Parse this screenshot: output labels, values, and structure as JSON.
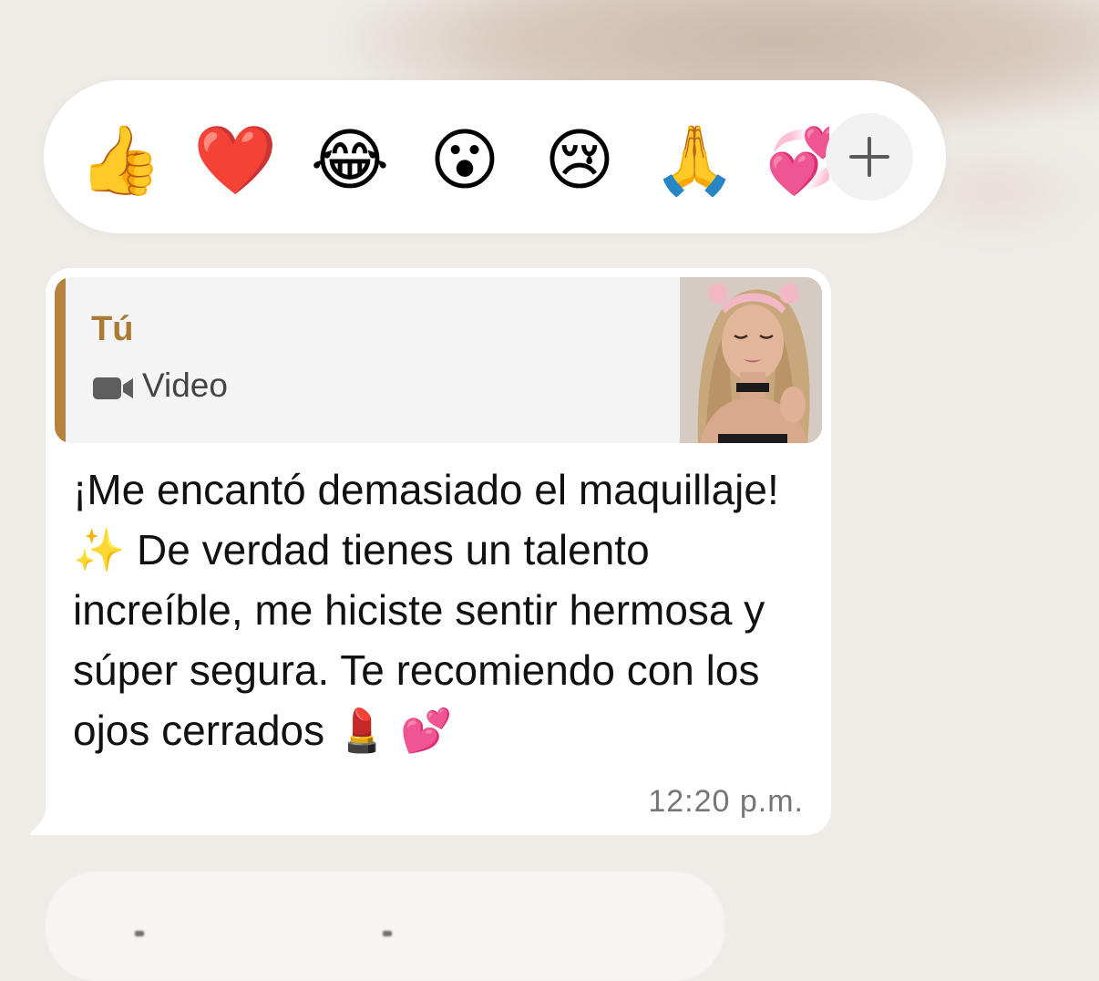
{
  "reaction_bar": {
    "emojis": [
      {
        "char": "👍",
        "name": "thumbs-up"
      },
      {
        "char": "❤️",
        "name": "red-heart"
      },
      {
        "char": "😂",
        "name": "tears-of-joy"
      },
      {
        "char": "😮",
        "name": "open-mouth"
      },
      {
        "char": "😢",
        "name": "crying-face"
      },
      {
        "char": "🙏",
        "name": "folded-hands"
      }
    ],
    "partial_emoji": "💞",
    "more_icon": "plus-icon"
  },
  "message": {
    "quote": {
      "author": "Tú",
      "type_label": "Video",
      "icon": "video-camera-icon",
      "accent_color": "#b2843e"
    },
    "text": "¡Me encantó demasiado el maquillaje! ✨ De verdad tienes un talento increíble, me hiciste sentir hermosa y súper segura. Te recomiendo con los ojos cerrados 💄 💕",
    "time": "12:20 p.m."
  }
}
